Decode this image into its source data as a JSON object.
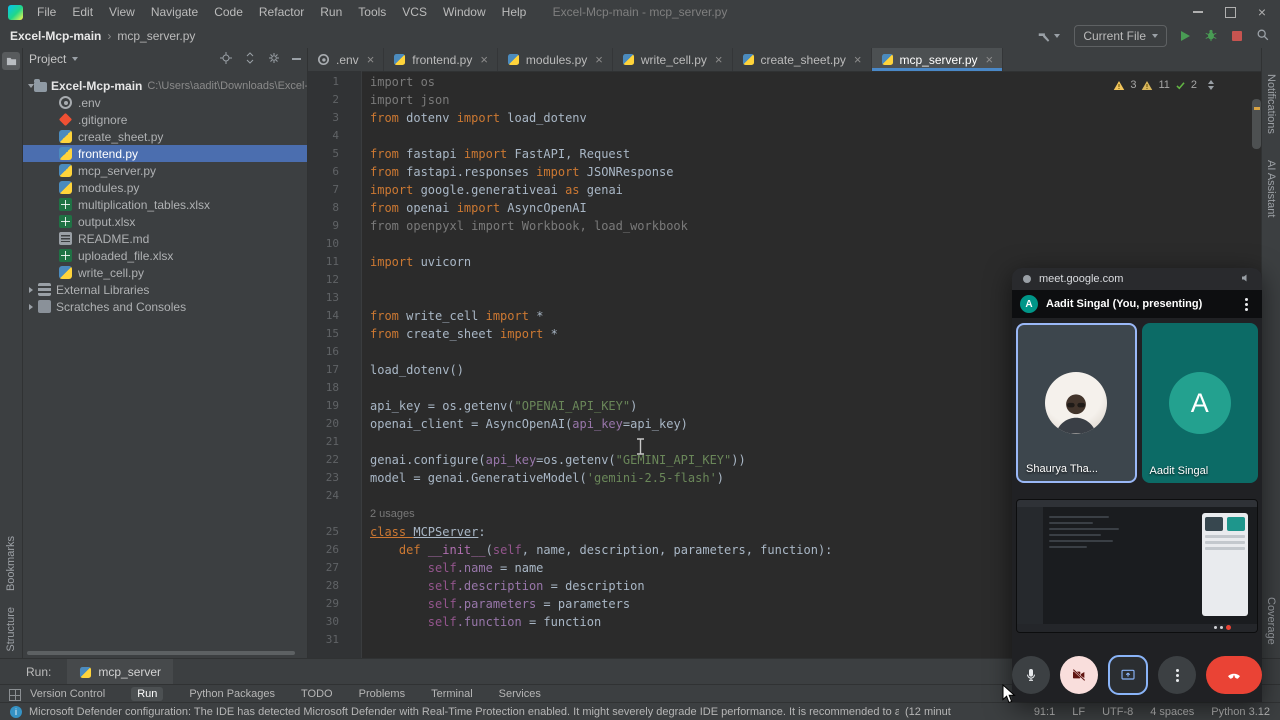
{
  "window": {
    "title": "Excel-Mcp-main - mcp_server.py",
    "menu": [
      "File",
      "Edit",
      "View",
      "Navigate",
      "Code",
      "Refactor",
      "Run",
      "Tools",
      "VCS",
      "Window",
      "Help"
    ]
  },
  "breadcrumb": {
    "project": "Excel-Mcp-main",
    "file": "mcp_server.py"
  },
  "toolbar": {
    "run_config": "Current File"
  },
  "project_panel": {
    "header": "Project",
    "root": {
      "name": "Excel-Mcp-main",
      "path": "C:\\Users\\aadit\\Downloads\\Excel-Mcp-r"
    },
    "items": [
      {
        "name": ".env",
        "icon": "env-file-icon"
      },
      {
        "name": ".gitignore",
        "icon": "git-file-icon"
      },
      {
        "name": "create_sheet.py",
        "icon": "python-file-icon"
      },
      {
        "name": "frontend.py",
        "icon": "python-file-icon",
        "selected": true
      },
      {
        "name": "mcp_server.py",
        "icon": "python-file-icon"
      },
      {
        "name": "modules.py",
        "icon": "python-file-icon"
      },
      {
        "name": "multiplication_tables.xlsx",
        "icon": "excel-file-icon"
      },
      {
        "name": "output.xlsx",
        "icon": "excel-file-icon"
      },
      {
        "name": "README.md",
        "icon": "markdown-file-icon"
      },
      {
        "name": "uploaded_file.xlsx",
        "icon": "excel-file-icon"
      },
      {
        "name": "write_cell.py",
        "icon": "python-file-icon"
      }
    ],
    "special": [
      {
        "name": "External Libraries",
        "icon": "libraries-icon"
      },
      {
        "name": "Scratches and Consoles",
        "icon": "scratches-icon"
      }
    ]
  },
  "editor": {
    "tabs": [
      {
        "label": ".env",
        "icon": "env-file-icon"
      },
      {
        "label": "frontend.py",
        "icon": "python-file-icon"
      },
      {
        "label": "modules.py",
        "icon": "python-file-icon"
      },
      {
        "label": "write_cell.py",
        "icon": "python-file-icon"
      },
      {
        "label": "create_sheet.py",
        "icon": "python-file-icon"
      },
      {
        "label": "mcp_server.py",
        "icon": "python-file-icon",
        "active": true
      }
    ],
    "inspections": {
      "a": "3",
      "b": "11",
      "c": "2"
    },
    "lines": [
      {
        "n": 1,
        "tokens": [
          [
            "import os",
            "g"
          ]
        ]
      },
      {
        "n": 2,
        "tokens": [
          [
            "import json",
            "g"
          ]
        ]
      },
      {
        "n": 3,
        "tokens": [
          [
            "from ",
            "k"
          ],
          [
            "dotenv ",
            "t"
          ],
          [
            "import ",
            "k"
          ],
          [
            "load_dotenv",
            "t"
          ]
        ]
      },
      {
        "n": 4,
        "tokens": []
      },
      {
        "n": 5,
        "tokens": [
          [
            "from ",
            "k"
          ],
          [
            "fastapi ",
            "t"
          ],
          [
            "import ",
            "k"
          ],
          [
            "FastAPI, Request",
            "t"
          ]
        ]
      },
      {
        "n": 6,
        "tokens": [
          [
            "from ",
            "k"
          ],
          [
            "fastapi.responses ",
            "t"
          ],
          [
            "import ",
            "k"
          ],
          [
            "JSONResponse",
            "t"
          ]
        ]
      },
      {
        "n": 7,
        "tokens": [
          [
            "import ",
            "k"
          ],
          [
            "google.generativeai ",
            "t"
          ],
          [
            "as ",
            "k"
          ],
          [
            "genai",
            "t"
          ]
        ]
      },
      {
        "n": 8,
        "tokens": [
          [
            "from ",
            "k"
          ],
          [
            "openai ",
            "t"
          ],
          [
            "import ",
            "k"
          ],
          [
            "AsyncOpenAI",
            "t"
          ]
        ]
      },
      {
        "n": 9,
        "tokens": [
          [
            "from openpyxl import Workbook, load_workbook",
            "g"
          ]
        ]
      },
      {
        "n": 10,
        "tokens": []
      },
      {
        "n": 11,
        "tokens": [
          [
            "import ",
            "k"
          ],
          [
            "uvicorn",
            "t"
          ]
        ]
      },
      {
        "n": 12,
        "tokens": []
      },
      {
        "n": 13,
        "tokens": []
      },
      {
        "n": 14,
        "tokens": [
          [
            "from ",
            "k"
          ],
          [
            "write_cell ",
            "t"
          ],
          [
            "import ",
            "k"
          ],
          [
            "*",
            "t"
          ]
        ]
      },
      {
        "n": 15,
        "tokens": [
          [
            "from ",
            "k"
          ],
          [
            "create_sheet ",
            "t"
          ],
          [
            "import ",
            "k"
          ],
          [
            "*",
            "t"
          ]
        ]
      },
      {
        "n": 16,
        "tokens": []
      },
      {
        "n": 17,
        "tokens": [
          [
            "load_dotenv()",
            "t"
          ]
        ]
      },
      {
        "n": 18,
        "tokens": []
      },
      {
        "n": 19,
        "tokens": [
          [
            "api_key = os.getenv(",
            "t"
          ],
          [
            "\"OPENAI_API_KEY\"",
            "s"
          ],
          [
            ")",
            "t"
          ]
        ]
      },
      {
        "n": 20,
        "tokens": [
          [
            "openai_client = AsyncOpenAI(",
            "t"
          ],
          [
            "api_key",
            "f"
          ],
          [
            "=api_key)",
            "t"
          ]
        ]
      },
      {
        "n": 21,
        "tokens": []
      },
      {
        "n": 22,
        "tokens": [
          [
            "genai.configure(",
            "t"
          ],
          [
            "api_key",
            "f"
          ],
          [
            "=os.getenv(",
            "t"
          ],
          [
            "\"GEMINI_API_KEY\"",
            "s"
          ],
          [
            "))",
            "t"
          ]
        ]
      },
      {
        "n": 23,
        "tokens": [
          [
            "model = genai.GenerativeModel(",
            "t"
          ],
          [
            "'gemini-2.5-flash'",
            "s"
          ],
          [
            ")",
            "t"
          ]
        ]
      },
      {
        "n": 24,
        "tokens": []
      },
      {
        "n": 25,
        "inlay": "2 usages",
        "tokens": [
          [
            "class ",
            "k u"
          ],
          [
            "MCPServer",
            "t u"
          ],
          [
            ":",
            "t"
          ]
        ]
      },
      {
        "n": 26,
        "tokens": [
          [
            "    ",
            "t"
          ],
          [
            "def ",
            "k"
          ],
          [
            "__init__",
            "m"
          ],
          [
            "(",
            "t"
          ],
          [
            "self",
            "p"
          ],
          [
            ", name, description, parameters, function):",
            "t"
          ]
        ]
      },
      {
        "n": 27,
        "tokens": [
          [
            "        ",
            "t"
          ],
          [
            "self",
            "p"
          ],
          [
            ".name",
            "f"
          ],
          [
            " = name",
            "t"
          ]
        ]
      },
      {
        "n": 28,
        "tokens": [
          [
            "        ",
            "t"
          ],
          [
            "self",
            "p"
          ],
          [
            ".description",
            "f"
          ],
          [
            " = description",
            "t"
          ]
        ]
      },
      {
        "n": 29,
        "tokens": [
          [
            "        ",
            "t"
          ],
          [
            "self",
            "p"
          ],
          [
            ".parameters",
            "f"
          ],
          [
            " = parameters",
            "t"
          ]
        ]
      },
      {
        "n": 30,
        "tokens": [
          [
            "        ",
            "t"
          ],
          [
            "self",
            "p"
          ],
          [
            ".function",
            "f"
          ],
          [
            " = function",
            "t"
          ]
        ]
      },
      {
        "n": 31,
        "tokens": []
      }
    ]
  },
  "run_panel": {
    "label": "Run:",
    "tab": "mcp_server"
  },
  "statusbar": {
    "tool_buttons": [
      "Version Control",
      "Run",
      "Python Packages",
      "TODO",
      "Problems",
      "Terminal",
      "Services"
    ],
    "message": "Microsoft Defender configuration: The IDE has detected Microsoft Defender with Real-Time Protection enabled. It might severely degrade IDE performance. It is recommended to add the following paths to the Defend...",
    "age": "(12 minut",
    "caret": "91:1",
    "line_ending": "LF",
    "encoding": "UTF-8",
    "indent": "4 spaces",
    "interpreter": "Python 3.12"
  },
  "strips": {
    "left_bottom": [
      "Bookmarks",
      "Structure"
    ],
    "right_top": [
      "Notifications",
      "AI Assistant"
    ],
    "right_bottom": [
      "Coverage"
    ]
  },
  "meet": {
    "url": "meet.google.com",
    "presenter": {
      "initial": "A",
      "label": "Aadit Singal (You, presenting)"
    },
    "participants": [
      {
        "name": "Shaurya Tha...",
        "type": "photo"
      },
      {
        "name": "Aadit Singal",
        "initial": "A",
        "type": "initial"
      }
    ]
  }
}
